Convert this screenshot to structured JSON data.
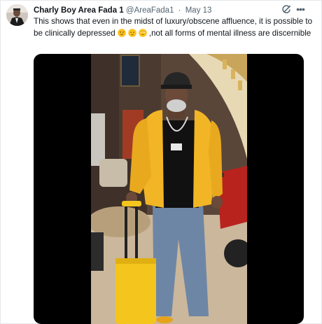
{
  "tweet": {
    "author_name": "Charly Boy Area Fada 1",
    "handle": "@AreaFada1",
    "separator": "·",
    "date": "May 13",
    "text_part1": "This shows that even in the midst of luxury/obscene affluence, it is possible to be clinically depressed",
    "text_part2": ",not all forms of mental illness are discernible",
    "emojis": [
      "disappointed-face",
      "worried-face",
      "face-with-rolling-eyes"
    ],
    "more_label": "•••"
  },
  "icons": {
    "grok": "grok-icon",
    "more": "more-options-icon",
    "avatar": "avatar"
  },
  "colors": {
    "text_primary": "#0f1419",
    "text_secondary": "#536471",
    "media_background": "#000000",
    "jacket": "#f2b526",
    "suitcase": "#f4c51c"
  }
}
